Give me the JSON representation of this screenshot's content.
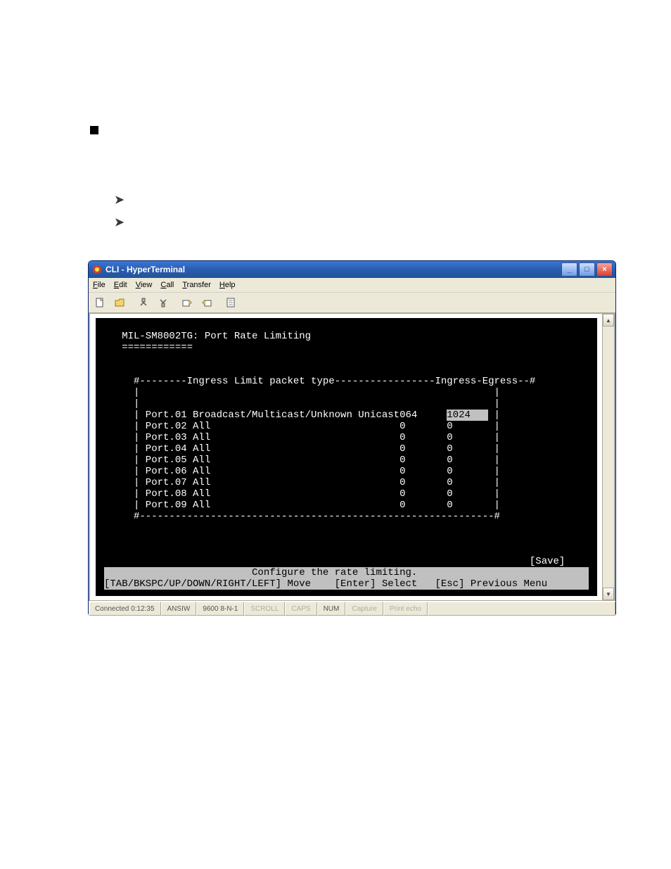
{
  "bullets": {
    "arrow": "➤"
  },
  "window": {
    "title": "CLI - HyperTerminal",
    "menu": {
      "file": "File",
      "edit": "Edit",
      "view": "View",
      "call": "Call",
      "transfer": "Transfer",
      "help": "Help"
    },
    "winbtns": {
      "min": "_",
      "max": "□",
      "close": "×"
    }
  },
  "terminal": {
    "heading": "MIL-SM8002TG: Port Rate Limiting",
    "hrule": "============",
    "table": {
      "header_left": "Ingress Limit packet type",
      "header_right1": "Ingress",
      "header_right2": "Egress",
      "rows": [
        {
          "port": "Port.01",
          "type": "Broadcast/Multicast/Unknown Unicast",
          "ingress": "064",
          "egress": "1024",
          "egress_hl": true
        },
        {
          "port": "Port.02",
          "type": "All",
          "ingress": "0",
          "egress": "0"
        },
        {
          "port": "Port.03",
          "type": "All",
          "ingress": "0",
          "egress": "0"
        },
        {
          "port": "Port.04",
          "type": "All",
          "ingress": "0",
          "egress": "0"
        },
        {
          "port": "Port.05",
          "type": "All",
          "ingress": "0",
          "egress": "0"
        },
        {
          "port": "Port.06",
          "type": "All",
          "ingress": "0",
          "egress": "0"
        },
        {
          "port": "Port.07",
          "type": "All",
          "ingress": "0",
          "egress": "0"
        },
        {
          "port": "Port.08",
          "type": "All",
          "ingress": "0",
          "egress": "0"
        },
        {
          "port": "Port.09",
          "type": "All",
          "ingress": "0",
          "egress": "0"
        }
      ]
    },
    "save": "[Save]",
    "helpbar": "Configure the rate limiting.",
    "navbar": "[TAB/BKSPC/UP/DOWN/RIGHT/LEFT] Move    [Enter] Select   [Esc] Previous Menu"
  },
  "status": {
    "connected": "Connected 0:12:35",
    "emul": "ANSIW",
    "params": "9600 8-N-1",
    "scroll": "SCROLL",
    "caps": "CAPS",
    "num": "NUM",
    "capture": "Capture",
    "echo": "Print echo"
  }
}
